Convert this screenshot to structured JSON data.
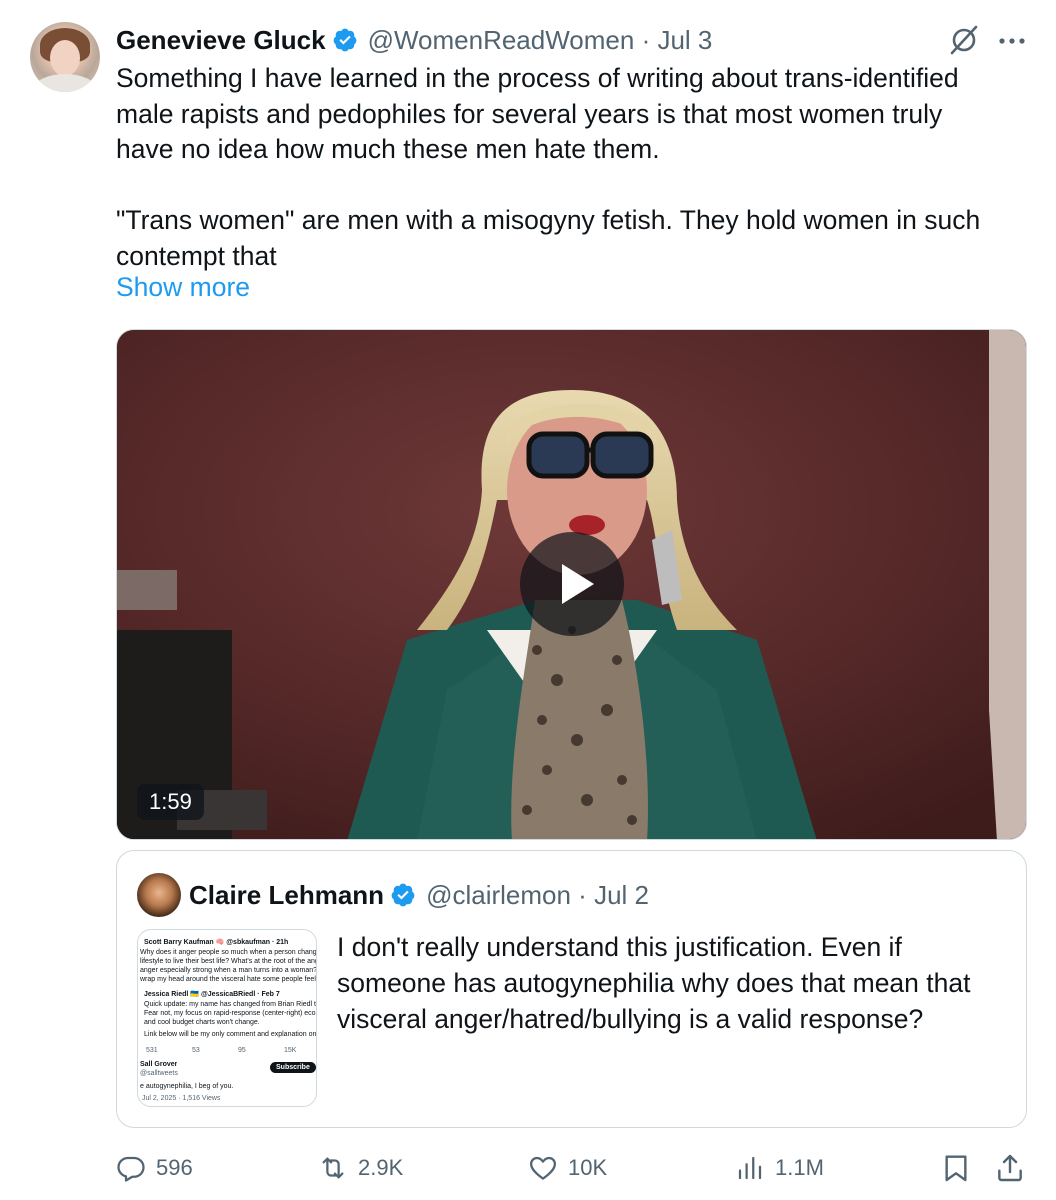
{
  "author": {
    "name": "Genevieve Gluck",
    "handle": "@WomenReadWomen",
    "date": "Jul 3",
    "verified": true
  },
  "post": {
    "text": "Something I have learned in the process of writing about trans-identified\nmale rapists and pedophiles for several years is that most women truly\nhave no idea how much these men hate them.\n\n\"Trans women\" are men with a misogyny fetish. They hold women in such\ncontempt that",
    "show_more": "Show more"
  },
  "media": {
    "type": "video",
    "duration": "1:59"
  },
  "quote": {
    "name": "Claire Lehmann",
    "handle": "@clairlemon",
    "date": "Jul 2",
    "verified": true,
    "text": "I don't really understand this justification. Even if someone has autogynephilia why does that mean that visceral anger/hatred/bullying is a valid response?",
    "thumb": {
      "line1": "Scott Barry Kaufman 🧠 @sbkaufman · 21h",
      "line2": "Why does it anger people so much when a person changes their na",
      "line3": "lifestyle to live their best life? What's at the root of the anger? Why is",
      "line4": "anger especially strong when a man turns into a woman? I want to re",
      "line5": "wrap my head around the visceral hate some people feel.",
      "line6": "Jessica Riedl 🇺🇦 @JessicaBRiedl · Feb 7",
      "line7": "Quick update: my name has changed from Brian Riedl to Jessica R",
      "line8": "Fear not, my focus on rapid-response (center-right) economic poli",
      "line9": "and cool budget charts won't change.",
      "line10": "Link below will be my only comment and explanation on this. Back",
      "stat1": "531",
      "stat2": "53",
      "stat3": "95",
      "stat4": "15K",
      "line11": "Sall Grover",
      "line12": "@salltweets",
      "subscribe": "Subscribe",
      "line13": "e autogynephilia, I beg of you.",
      "line14": "Jul 2, 2025 · 1,516 Views"
    }
  },
  "actions": {
    "replies": "596",
    "reposts": "2.9K",
    "likes": "10K",
    "views": "1.1M"
  },
  "colors": {
    "accent": "#1d9bf0",
    "secondary_text": "#536471",
    "verified": "#1d9bf0"
  }
}
